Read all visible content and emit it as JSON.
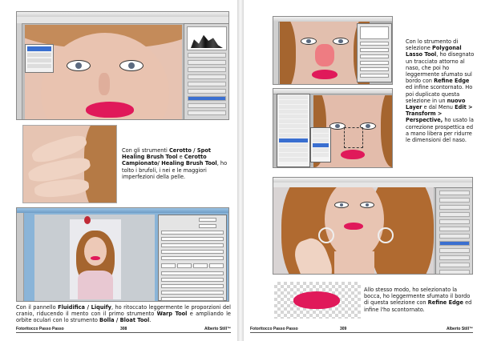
{
  "left_page": {
    "text1_parts": [
      "Con gli strumenti ",
      "Cerotto / Spot Healing Brush Tool",
      " e ",
      "Cerotto Campionato/ Healing Brush Tool",
      ", ho tolto i brufoli, i nei e le maggiori imperfezioni della pelle."
    ],
    "text2_parts": [
      "Con il pannello ",
      "Fluidifica / Liquify",
      ", ho ritoccato leggermente le proporzioni del cranio, riducendo il mento con il primo strumento ",
      "Warp Tool",
      " e ampliando le orbite oculari con lo strumento ",
      "Bolla / Bloat Tool",
      "."
    ],
    "footer": {
      "book": "Fotoritocco Passo Passo",
      "page_number": "308",
      "author": "Alberto Still™"
    }
  },
  "right_page": {
    "text1_parts": [
      "Con lo strumento di selezione ",
      "Polygonal Lasso Tool",
      ", ho disegnato un tracciato attorno al naso, che poi ho leggermente sfumato sul bordo con ",
      "Refine Edge",
      " ed infine scontornato. Ho poi duplicato questa selezione in un ",
      "nuovo Layer",
      " e dal Menu ",
      "Edit > Transform > Perspective,",
      " ho usato la correzione prospettica ed a mano libera per ridurre le dimensioni del naso."
    ],
    "text2_parts": [
      "Allo stesso modo, ho selezionato la bocca, ho leggermente sfumato il bordo di questa selezione con ",
      "Refine Edge",
      " ed infine l'ho scontornato."
    ],
    "footer": {
      "book": "Fotoritocco Passo Passo",
      "page_number": "309",
      "author": "Alberto Still™"
    }
  },
  "colors": {
    "lip": "#e0195a",
    "skin": "#e9c3b0",
    "hair": "#a5652f",
    "ps_panel": "#d6d6d6",
    "liquify_bg": "#8ab4d8",
    "selection_blue": "#3a6fd0",
    "nose_highlight": "#f0707a"
  }
}
